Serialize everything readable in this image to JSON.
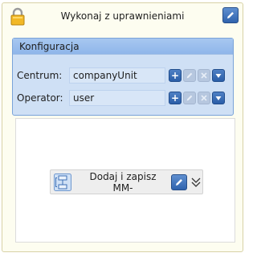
{
  "activity": {
    "title": "Wykonaj z uprawnieniami",
    "icon": "lock-icon",
    "edit_icon": "pencil-icon"
  },
  "config": {
    "title": "Konfiguracja",
    "rows": [
      {
        "label": "Centrum:",
        "value": "companyUnit"
      },
      {
        "label": "Operator:",
        "value": "user"
      }
    ],
    "buttons": {
      "add": "+",
      "edit_icon": "pencil-icon",
      "remove_icon": "x-icon",
      "dropdown_icon": "triangle-down-icon"
    }
  },
  "action": {
    "line1": "Dodaj i zapisz",
    "line2": "MM-",
    "icon": "flow-icon",
    "edit_icon": "pencil-icon",
    "expand_icon": "double-chevron-down-icon"
  },
  "colors": {
    "activity_bg": "#fdfdf0",
    "config_bg": "#cfe0f5",
    "button_blue": "#2f63ad"
  }
}
